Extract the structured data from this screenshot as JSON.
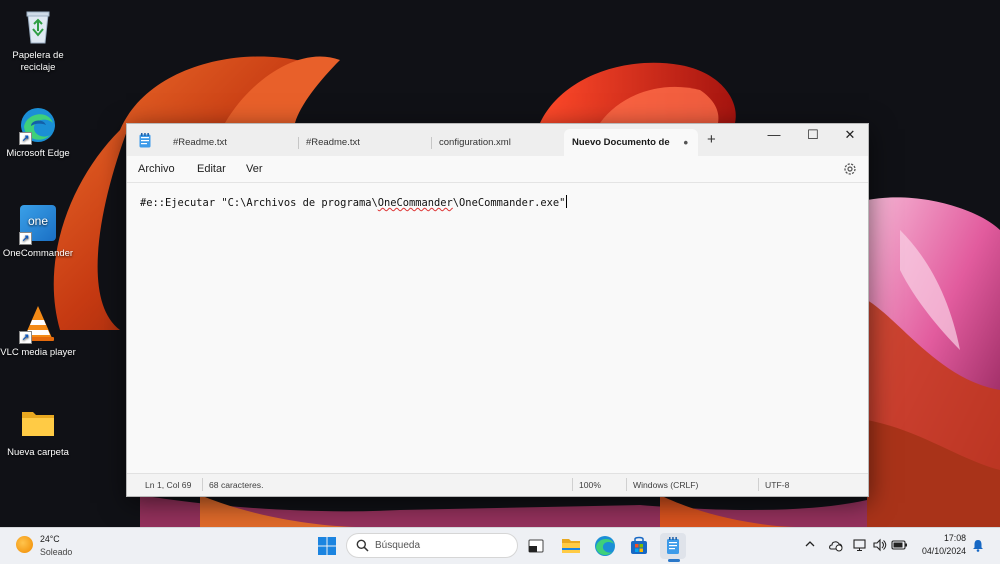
{
  "desktop": {
    "icons": [
      {
        "label": "Papelera de reciclaje",
        "icon": "recycle-bin-icon"
      },
      {
        "label": "Microsoft Edge",
        "icon": "edge-icon"
      },
      {
        "label": "OneCommander",
        "icon": "onecommander-icon",
        "icon_text": "one"
      },
      {
        "label": "VLC media player",
        "icon": "vlc-icon"
      },
      {
        "label": "Nueva carpeta",
        "icon": "folder-icon"
      }
    ]
  },
  "notepad": {
    "app_icon": "notepad-icon",
    "tabs": [
      {
        "label": "#Readme.txt",
        "active": false
      },
      {
        "label": "#Readme.txt",
        "active": false
      },
      {
        "label": "configuration.xml",
        "active": false
      },
      {
        "label": "Nuevo Documento de",
        "active": true,
        "unsaved_dot": "•"
      }
    ],
    "new_tab_label": "+",
    "window_controls": {
      "minimize": "—",
      "maximize": "☐",
      "close": "✕"
    },
    "menu": [
      "Archivo",
      "Editar",
      "Ver"
    ],
    "settings_icon": "gear-icon",
    "content": {
      "before": "#e::Ejecutar \"C:\\Archivos de programa\\",
      "misspelled": "OneCommander",
      "after": "\\OneCommander.exe\""
    },
    "status": {
      "position": "Ln 1, Col 69",
      "chars": "68 caracteres.",
      "zoom": "100%",
      "line_ending": "Windows (CRLF)",
      "encoding": "UTF-8"
    }
  },
  "taskbar": {
    "weather": {
      "temp": "24°C",
      "desc": "Soleado",
      "icon": "sun-icon"
    },
    "search_placeholder": "Búsqueda",
    "apps": [
      "start-icon",
      "search-icon",
      "app-icon",
      "file-explorer-icon",
      "edge-icon",
      "store-icon",
      "notepad-icon"
    ],
    "tray_icons": [
      "chevron-up-icon",
      "onedrive-icon",
      "network-icon",
      "speaker-icon",
      "battery-icon",
      "notification-icon"
    ],
    "clock": {
      "time": "17:08",
      "date": "04/10/2024"
    }
  },
  "colors": {
    "accent": "#0067c0",
    "wallpaper_orange": "#d9531e",
    "wallpaper_pink": "#e86aa8"
  }
}
